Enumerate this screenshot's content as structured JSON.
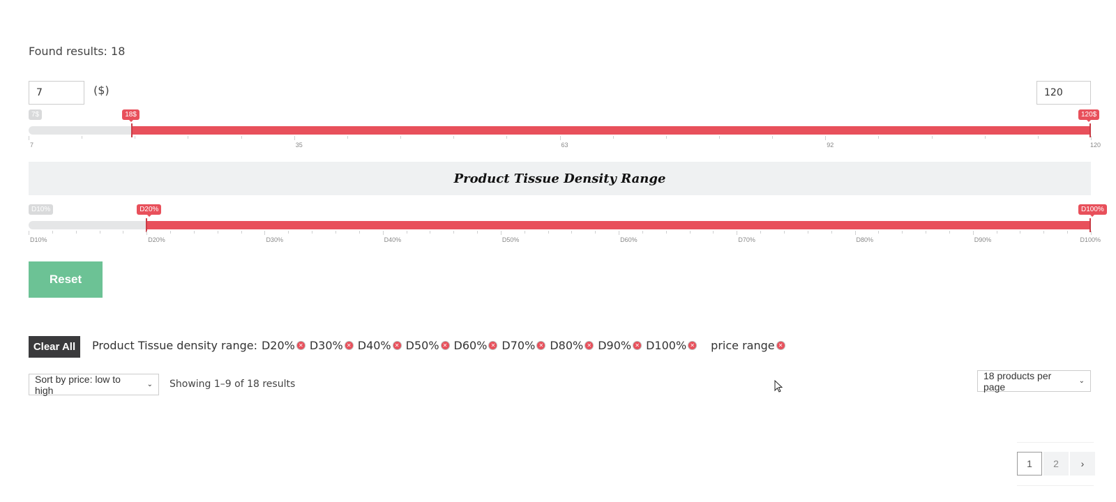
{
  "found_results": "Found results: 18",
  "price_filter": {
    "min_value": "7",
    "max_value": "120",
    "currency_label": "($)",
    "min_label": "7$",
    "from_label": "18$",
    "to_label": "120$",
    "from_fraction": 0.0973,
    "to_fraction": 1.0,
    "scale_labels": [
      "7",
      "35",
      "63",
      "92",
      "120"
    ]
  },
  "density_filter": {
    "title": "Product Tissue Density Range",
    "min_label": "D10%",
    "from_label": "D20%",
    "to_label": "D100%",
    "from_fraction": 0.1111,
    "to_fraction": 1.0,
    "scale_labels": [
      "D10%",
      "D20%",
      "D30%",
      "D40%",
      "D50%",
      "D60%",
      "D70%",
      "D80%",
      "D90%",
      "D100%"
    ]
  },
  "reset_label": "Reset",
  "active_filters": {
    "clear_all_label": "Clear All",
    "density_prefix": "Product Tissue density range:",
    "density_chips": [
      "D20%",
      "D30%",
      "D40%",
      "D50%",
      "D60%",
      "D70%",
      "D80%",
      "D90%",
      "D100%"
    ],
    "price_chip": "price range"
  },
  "sort": {
    "selected": "Sort by price: low to high"
  },
  "showing_text": "Showing 1–9 of 18 results",
  "per_page": {
    "selected": "18 products per page"
  },
  "pagination": {
    "pages": [
      "1",
      "2"
    ],
    "current": "1",
    "next_glyph": "›"
  },
  "colors": {
    "accent": "#e8505b",
    "reset": "#6cc295",
    "clear_all": "#3a3a3c"
  }
}
